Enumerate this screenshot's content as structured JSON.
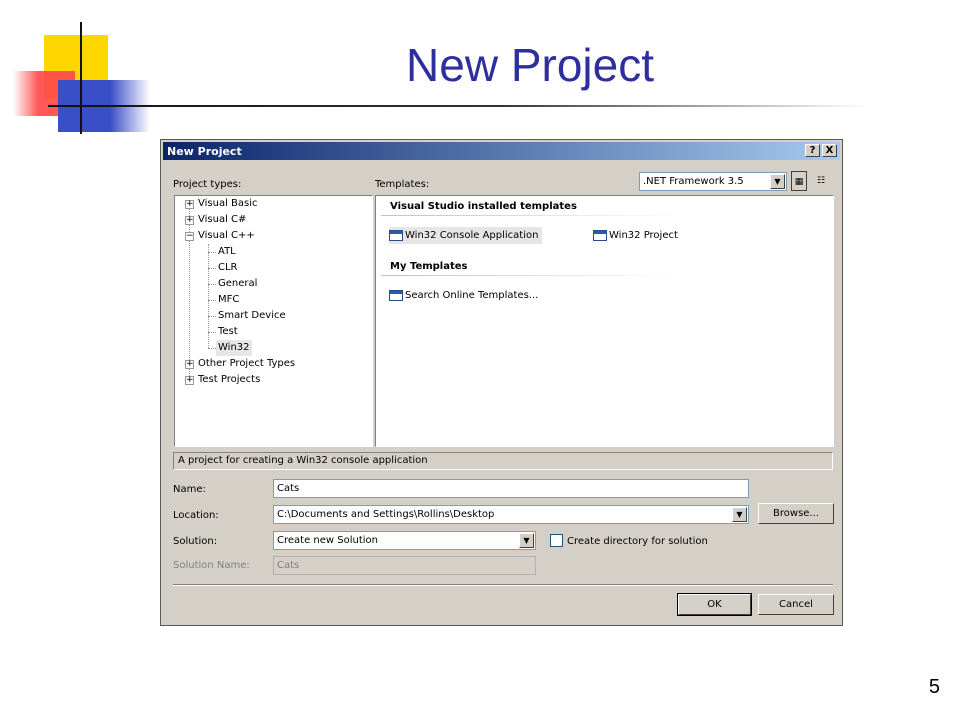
{
  "slide": {
    "title": "New Project",
    "page_number": "5"
  },
  "dialog": {
    "title": "New Project",
    "help_button": "?",
    "close_button": "X",
    "project_types_label": "Project types:",
    "templates_label": "Templates:",
    "framework": {
      "selected": ".NET Framework 3.5"
    },
    "tree": {
      "visual_basic": "Visual Basic",
      "visual_csharp": "Visual C#",
      "visual_cpp": "Visual C++",
      "atl": "ATL",
      "clr": "CLR",
      "general": "General",
      "mfc": "MFC",
      "smart_device": "Smart Device",
      "test": "Test",
      "win32": "Win32",
      "other_project_types": "Other Project Types",
      "test_projects": "Test Projects"
    },
    "installed_header": "Visual Studio installed templates",
    "templates": {
      "win32_console": "Win32 Console Application",
      "win32_project": "Win32 Project"
    },
    "my_templates_header": "My Templates",
    "search_online": "Search Online Templates...",
    "description": "A project for creating a Win32 console application",
    "name_label": "Name:",
    "name_value": "Cats",
    "location_label": "Location:",
    "location_value": "C:\\Documents and Settings\\Rollins\\Desktop",
    "browse_button": "Browse...",
    "solution_label": "Solution:",
    "solution_value": "Create new Solution",
    "create_dir_label": "Create directory for solution",
    "solution_name_label": "Solution Name:",
    "solution_name_value": "Cats",
    "ok_button": "OK",
    "cancel_button": "Cancel"
  }
}
